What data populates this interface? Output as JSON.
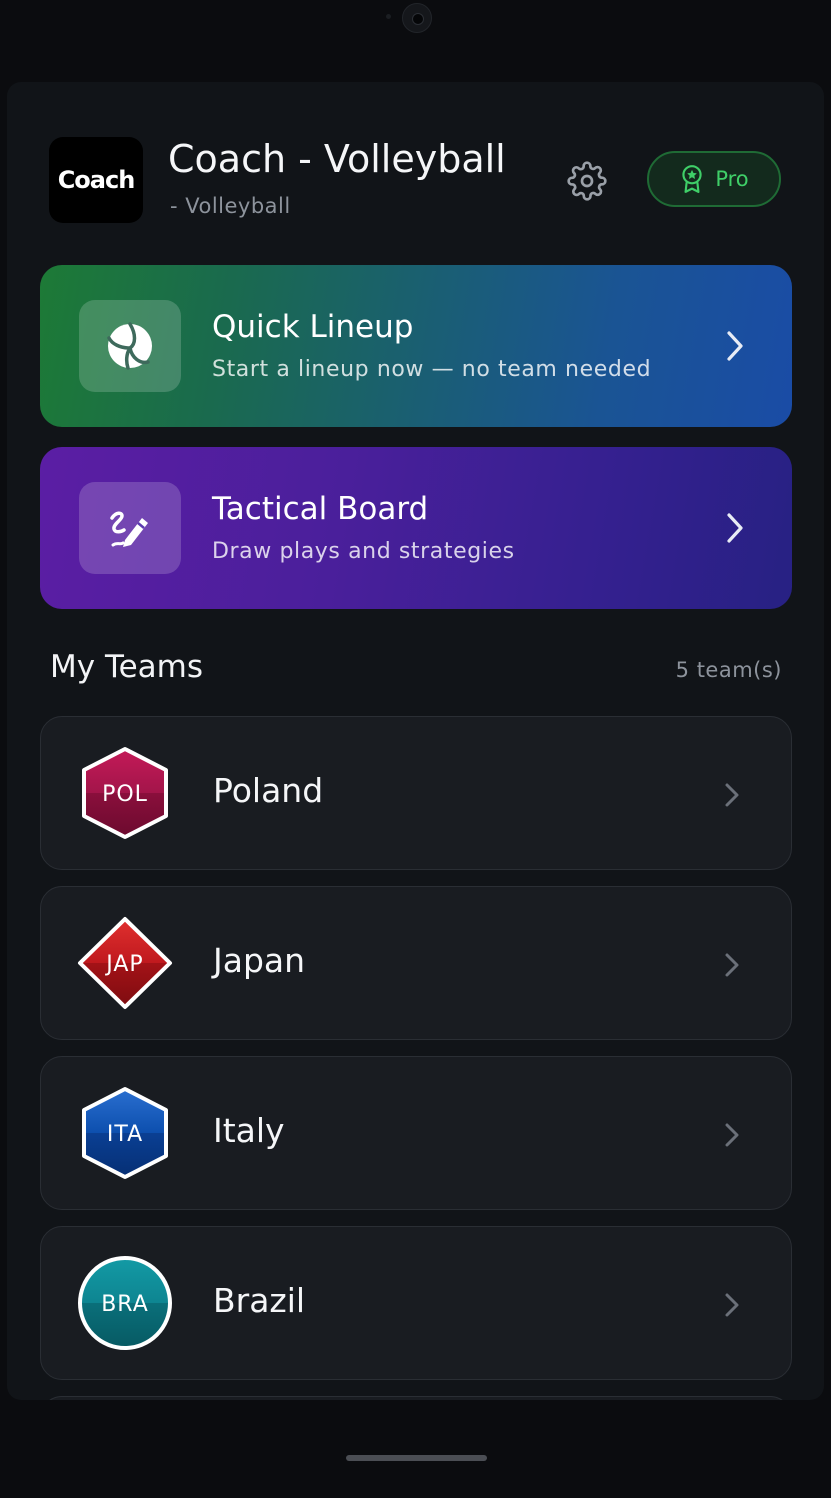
{
  "app": {
    "logo_text": "Coach",
    "title": "Coach - Volleyball",
    "subtitle": "- Volleyball",
    "pro_label": "Pro"
  },
  "actions": [
    {
      "title": "Quick Lineup",
      "subtitle": "Start a lineup now — no team needed",
      "icon": "volleyball-icon"
    },
    {
      "title": "Tactical Board",
      "subtitle": "Draw plays and strategies",
      "icon": "draw-pencil-icon"
    }
  ],
  "teams_section": {
    "title": "My Teams",
    "count": "5 team(s)"
  },
  "teams": [
    {
      "code": "POL",
      "name": "Poland",
      "badge_shape": "hexagon",
      "color": "#a3154a"
    },
    {
      "code": "JAP",
      "name": "Japan",
      "badge_shape": "diamond",
      "color": "#c0191e"
    },
    {
      "code": "ITA",
      "name": "Italy",
      "badge_shape": "hexagon",
      "color": "#0d4fae"
    },
    {
      "code": "BRA",
      "name": "Brazil",
      "badge_shape": "circle",
      "color": "#0e8591"
    }
  ],
  "colors": {
    "background": "#111418",
    "pro_green": "#3fcf68",
    "lineup_gradient": [
      "#1d7a36",
      "#1a4ca6"
    ],
    "tactical_gradient": [
      "#5b1ea4",
      "#272183"
    ]
  }
}
